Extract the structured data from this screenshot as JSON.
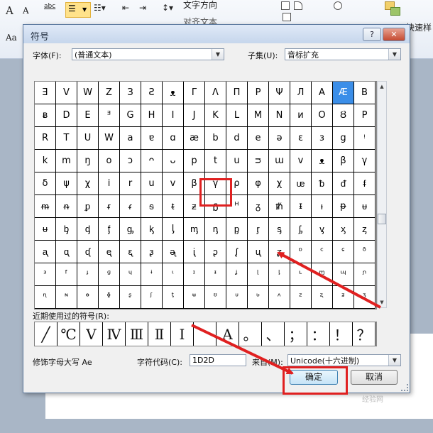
{
  "ribbon": {
    "font_size_up": "A",
    "font_size_down": "A",
    "format_painter": "abc",
    "aa_label": "Aa",
    "text_direction_label": "文字方向",
    "align_text_label": "对齐文本",
    "right_label": "快速样"
  },
  "dialog": {
    "title": "符号",
    "help_label": "?",
    "close_label": "✕",
    "font_label": "字体(F):",
    "font_value": "(普通文本)",
    "subset_label": "子集(U):",
    "subset_value": "音标扩充",
    "recent_label": "近期使用过的符号(R):",
    "char_name": "修饰字母大写 Ae",
    "char_code_label": "字符代码(C):",
    "char_code_value": "1D2D",
    "from_label": "来自(M):",
    "from_value": "Unicode(十六进制)",
    "ok_label": "确定",
    "cancel_label": "取消",
    "selected_char": "Æ"
  },
  "grid": [
    [
      "Ǝ",
      "V",
      "W",
      "Z",
      "З",
      "Ƨ",
      "ᴥ",
      "Γ",
      "Λ",
      "Π",
      "Ρ",
      "Ψ",
      "Л",
      "A",
      "Æ",
      "B"
    ],
    [
      "ᴃ",
      "D",
      "E",
      "ᴲ",
      "G",
      "H",
      "I",
      "J",
      "K",
      "L",
      "M",
      "N",
      "ᴎ",
      "O",
      "Ȣ",
      "P"
    ],
    [
      "R",
      "T",
      "U",
      "W",
      "a",
      "ɐ",
      "ɑ",
      "æ",
      "b",
      "d",
      "e",
      "ə",
      "ɛ",
      "ɜ",
      "g",
      "ᵎ"
    ],
    [
      "k",
      "m",
      "ŋ",
      "o",
      "ɔ",
      "ᴖ",
      "ᴗ",
      "p",
      "t",
      "u",
      "ᴝ",
      "ɯ",
      "v",
      "ᴥ",
      "β",
      "γ"
    ],
    [
      "δ",
      "ψ",
      "χ",
      "i",
      "r",
      "u",
      "v",
      "β",
      "γ",
      "ρ",
      "φ",
      "χ",
      "ᵫ",
      "ᵬ",
      "ᵭ",
      "ᵮ"
    ],
    [
      "ᵯ",
      "ᵰ",
      "ᵱ",
      "ᵲ",
      "ᵳ",
      "ᵴ",
      "ᵵ",
      "ᵶ",
      "ᵷ",
      "ᴴ",
      "ᵹ",
      "ᵺ",
      "ᵻ",
      "ᵼ",
      "ᵽ",
      "ᵾ"
    ],
    [
      "ᵾ",
      "ᶀ",
      "ᶁ",
      "ᶂ",
      "ᶃ",
      "ᶄ",
      "ᶅ",
      "ᶆ",
      "ᶇ",
      "ᶈ",
      "ᶉ",
      "ᶊ",
      "ᶋ",
      "ᶌ",
      "ᶍ",
      "ᶎ"
    ],
    [
      "ᶏ",
      "ᶐ",
      "ᶑ",
      "ᶒ",
      "ᶓ",
      "ᶔ",
      "ᶕ",
      "ᶖ",
      "ᶗ",
      "ᶘ",
      "ᶙ",
      "ᶚ",
      "ᶛ",
      "ᶜ",
      "ᶝ",
      "ᶞ"
    ],
    [
      "ᶟ",
      "ᶠ",
      "ᶡ",
      "ᶢ",
      "ᶣ",
      "ᶤ",
      "ᶥ",
      "ᶦ",
      "ᶧ",
      "ᶨ",
      "ᶩ",
      "ᶪ",
      "ᶫ",
      "ᶬ",
      "ᶭ",
      "ᶮ"
    ],
    [
      "ᶯ",
      "ᶰ",
      "ᶱ",
      "ᶲ",
      "ᶳ",
      "ᶴ",
      "ᶵ",
      "ᶶ",
      "ᶷ",
      "ᶸ",
      "ᶹ",
      "ᶺ",
      "ᶻ",
      "ᶼ",
      "ᶽ",
      "ᶾ"
    ]
  ],
  "recent": [
    "╱",
    "℃",
    "Ⅴ",
    "Ⅳ",
    "Ⅲ",
    "Ⅱ",
    "Ⅰ",
    "",
    "A",
    "。",
    "、",
    "；",
    "：",
    "！",
    "？"
  ],
  "watermark": "经验网"
}
